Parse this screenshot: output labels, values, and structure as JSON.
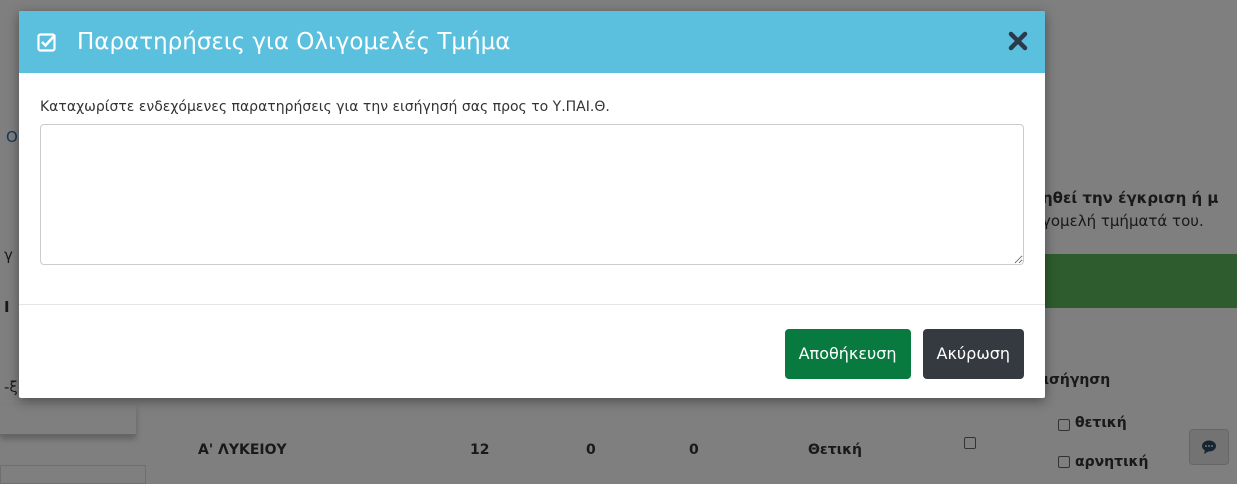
{
  "modal": {
    "title": "Παρατηρήσεις για Ολιγομελές Τμήμα",
    "label": "Καταχωρίστε ενδεχόμενες παρατηρήσεις για την εισήγησή σας προς το Υ.ΠΑΙ.Θ.",
    "textarea_value": "",
    "save_label": "Αποθήκευση",
    "cancel_label": "Ακύρωση"
  },
  "background": {
    "notice_line1": "ηθεί την έγκριση ή μ",
    "notice_line2": "γομελή τμήματά του.",
    "column_header": "Εισήγηση",
    "row": {
      "class": "Α' ΛΥΚΕΙΟΥ",
      "col1": "12",
      "col2": "0",
      "col3": "0",
      "result": "Θετική",
      "option_positive": "θετική",
      "option_negative": "αρνητική"
    }
  },
  "colors": {
    "header": "#5bc0de",
    "save": "#087a3f",
    "cancel": "#353a40"
  }
}
